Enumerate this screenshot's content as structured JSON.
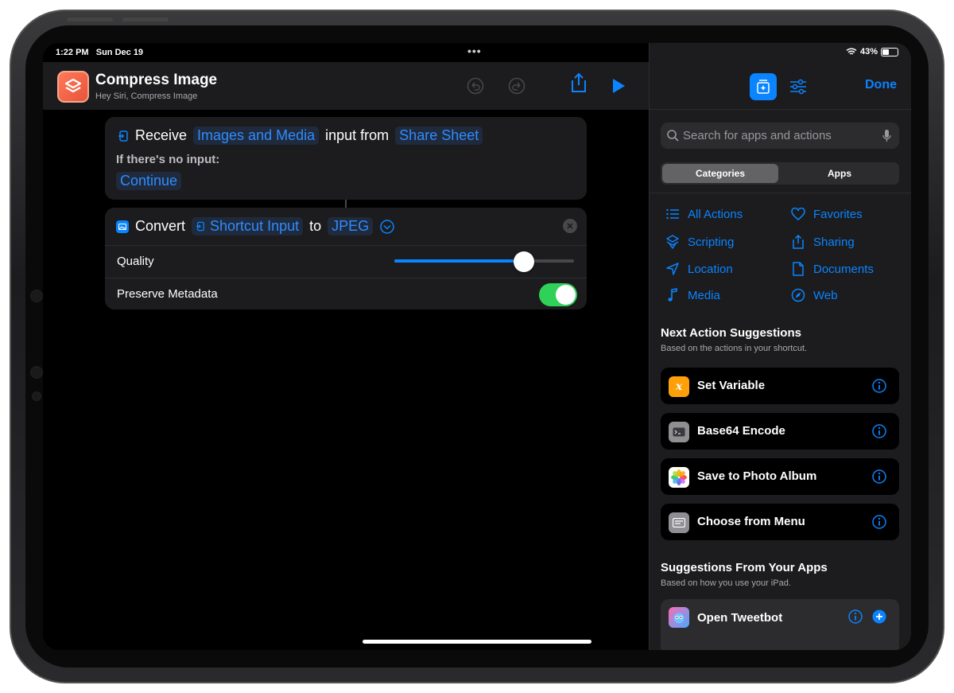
{
  "status": {
    "time": "1:22 PM",
    "date": "Sun Dec 19",
    "battery": "43%",
    "battery_level": 0.43
  },
  "header": {
    "title": "Compress Image",
    "subtitle": "Hey Siri, Compress Image"
  },
  "receive": {
    "verb": "Receive",
    "types": "Images and Media",
    "middle": "input from",
    "source": "Share Sheet",
    "no_input_label": "If there's no input:",
    "no_input_action": "Continue"
  },
  "convert": {
    "verb": "Convert",
    "input": "Shortcut Input",
    "to": "to",
    "format": "JPEG",
    "quality_label": "Quality",
    "quality_value": 0.72,
    "metadata_label": "Preserve Metadata",
    "metadata_on": true
  },
  "panel": {
    "done": "Done",
    "search_placeholder": "Search for apps and actions",
    "tabs": [
      "Categories",
      "Apps"
    ],
    "categories": [
      {
        "label": "All Actions",
        "icon": "list-icon"
      },
      {
        "label": "Favorites",
        "icon": "heart-icon"
      },
      {
        "label": "Scripting",
        "icon": "scripting-icon"
      },
      {
        "label": "Sharing",
        "icon": "share-icon"
      },
      {
        "label": "Location",
        "icon": "location-icon"
      },
      {
        "label": "Documents",
        "icon": "document-icon"
      },
      {
        "label": "Media",
        "icon": "music-note-icon"
      },
      {
        "label": "Web",
        "icon": "compass-icon"
      }
    ],
    "next_title": "Next Action Suggestions",
    "next_sub": "Based on the actions in your shortcut.",
    "suggestions": [
      {
        "label": "Set Variable",
        "color": "#ff9f0a"
      },
      {
        "label": "Base64 Encode",
        "color": "#8e8e93"
      },
      {
        "label": "Save to Photo Album",
        "color": "#ffffff"
      },
      {
        "label": "Choose from Menu",
        "color": "#8e8e93"
      }
    ],
    "apps_title": "Suggestions From Your Apps",
    "apps_sub": "Based on how you use your iPad.",
    "app_suggestion": "Open Tweetbot"
  }
}
